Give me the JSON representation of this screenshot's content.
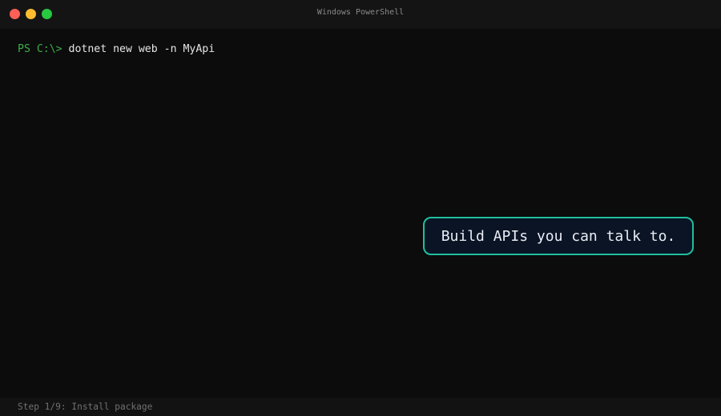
{
  "window": {
    "title": "Windows PowerShell",
    "controls": [
      {
        "name": "close",
        "color": "#ff5f57"
      },
      {
        "name": "minimize",
        "color": "#febc2e"
      },
      {
        "name": "maximize",
        "color": "#28c840"
      }
    ]
  },
  "terminal": {
    "prompt": "PS C:\\>",
    "command": "dotnet new web -n MyApi"
  },
  "callout": {
    "text": "Build APIs you can talk to."
  },
  "status": {
    "text": "Step 1/9: Install package"
  }
}
